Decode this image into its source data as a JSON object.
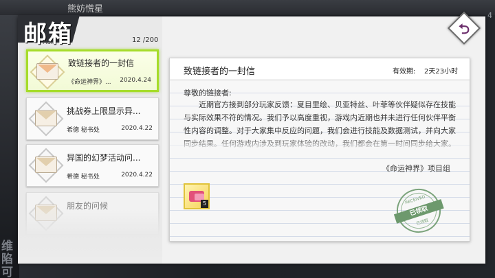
{
  "background": {
    "username": "熊妨慌星",
    "right_number": "4",
    "left_text": "维\n陷可"
  },
  "header": {
    "title": "邮箱",
    "subtitle": "Mail",
    "count": "12 /200"
  },
  "mail_list": [
    {
      "title": "致链接者的一封信",
      "sender": "《命运神界》...",
      "date": "2020.4.24",
      "selected": true
    },
    {
      "title": "挑战券上限显示异...",
      "sender": "希德 秘书处",
      "date": "2020.4.22",
      "selected": false
    },
    {
      "title": "异国的幻梦活动问...",
      "sender": "希德 秘书处",
      "date": "2020.4.22",
      "selected": false
    },
    {
      "title": "朋友的问候",
      "sender": "",
      "date": "",
      "selected": false
    }
  ],
  "content": {
    "title": "致链接者的一封信",
    "validity_label": "有效期:",
    "validity_value": "2天23小时",
    "greeting": "尊敬的链接者:",
    "body": "近期官方接到部分玩家反馈：夏目里绘、贝亚特丝、叶菲等伙伴疑似存在技能与实际效果不符的情况。我们予以高度重视，游戏内近期也并未进行任何伙伴平衡性内容的调整。对于大家集中反应的问题，我们会进行技能及数据测试，并向大家同步结果。任何游戏内涉及到玩家体验的改动，我们都会在第一时间同步给大家。",
    "signature": "《命运神界》项目组",
    "attachment": {
      "quantity": "5",
      "icon": "gem-bundle-icon"
    },
    "stamp": {
      "top": "RECEIVED",
      "label": "已领取",
      "bottom": "已领取"
    }
  },
  "back_button": {
    "glyph": "⮌",
    "icon": "back-arrow-icon"
  },
  "colors": {
    "selected_border": "#a6dc2a",
    "stamp_green": "#5f8f5f",
    "back_glyph": "#6b2d6b"
  }
}
